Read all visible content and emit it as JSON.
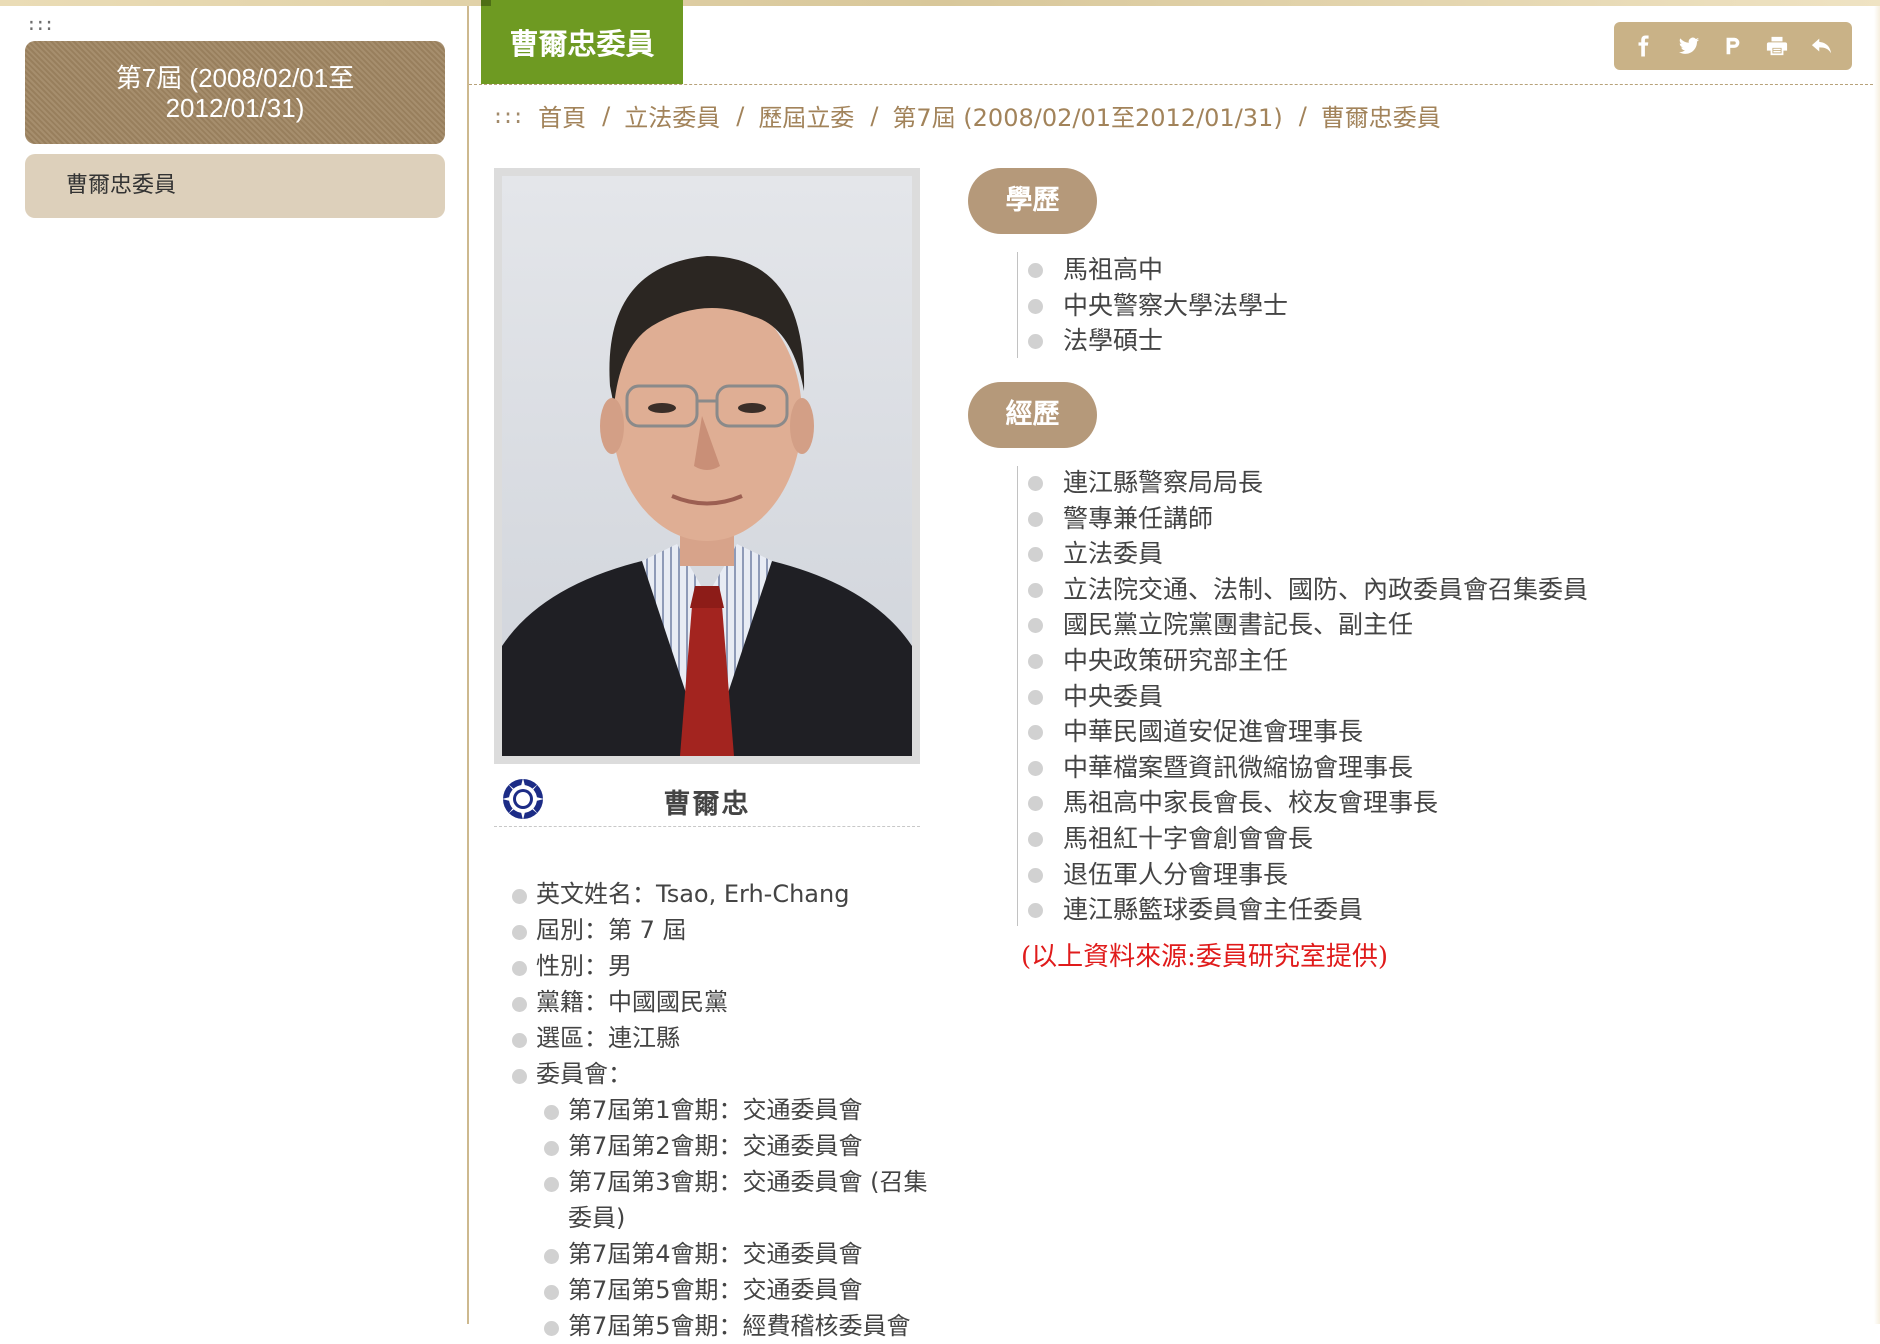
{
  "accesskey": ":::",
  "sidebar": {
    "term_label": "第7屆 (2008/02/01至2012/01/31)",
    "items": [
      {
        "label": "曹爾忠委員"
      }
    ]
  },
  "header": {
    "title": "曹爾忠委員",
    "tools": [
      "facebook-icon",
      "twitter-icon",
      "plurk-icon",
      "print-icon",
      "back-icon"
    ]
  },
  "breadcrumb": {
    "accesskey": ":::",
    "items": [
      "首頁",
      "立法委員",
      "歷屆立委",
      "第7屆 (2008/02/01至2012/01/31)",
      "曹爾忠委員"
    ],
    "separator": "/"
  },
  "profile": {
    "name": "曹爾忠",
    "party_icon": "kmt-emblem-icon",
    "info": [
      {
        "label": "英文姓名",
        "value": "Tsao, Erh-Chang"
      },
      {
        "label": "屆別",
        "value": "第 7 屆"
      },
      {
        "label": "性別",
        "value": "男"
      },
      {
        "label": "黨籍",
        "value": "中國國民黨"
      },
      {
        "label": "選區",
        "value": "連江縣"
      },
      {
        "label": "委員會",
        "value": ""
      }
    ],
    "committees": [
      "第7屆第1會期：交通委員會",
      "第7屆第2會期：交通委員會",
      "第7屆第3會期：交通委員會 (召集委員)",
      "第7屆第4會期：交通委員會",
      "第7屆第5會期：交通委員會",
      "第7屆第5會期：經費稽核委員會"
    ]
  },
  "education": {
    "heading": "學歷",
    "items": [
      "馬祖高中",
      "中央警察大學法學士",
      "法學碩士"
    ]
  },
  "experience": {
    "heading": "經歷",
    "items": [
      "連江縣警察局局長",
      "警專兼任講師",
      "立法委員",
      "立法院交通、法制、國防、內政委員會召集委員",
      "國民黨立院黨團書記長、副主任",
      "中央政策研究部主任",
      "中央委員",
      "中華民國道安促進會理事長",
      "中華檔案暨資訊微縮協會理事長",
      "馬祖高中家長會長、校友會理事長",
      "馬祖紅十字會創會會長",
      "退伍軍人分會理事長",
      "連江縣籃球委員會主任委員"
    ]
  },
  "source_note": "(以上資料來源:委員研究室提供)",
  "colors": {
    "accent_green": "#6e9a22",
    "tan": "#b5997a",
    "note_red": "#e01b1b"
  }
}
